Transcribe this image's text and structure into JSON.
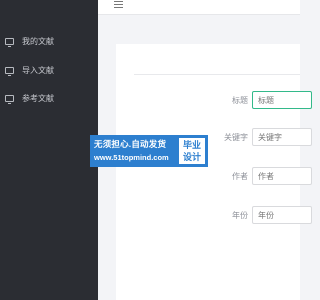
{
  "sidebar": {
    "items": [
      {
        "label": "我的文献",
        "icon": "monitor-icon"
      },
      {
        "label": "导入文献",
        "icon": "monitor-icon"
      },
      {
        "label": "参考文献",
        "icon": "monitor-icon"
      }
    ]
  },
  "header": {
    "menu_icon": "hamburger-icon"
  },
  "form": {
    "fields": [
      {
        "label": "标题",
        "placeholder": "标题"
      },
      {
        "label": "关键字",
        "placeholder": "关键字"
      },
      {
        "label": "作者",
        "placeholder": "作者"
      },
      {
        "label": "年份",
        "placeholder": "年份"
      }
    ]
  },
  "watermark": {
    "line1": "无须担心.自动发货",
    "line2": "www.51topmind.com",
    "badge_line1": "毕业",
    "badge_line2": "设计"
  },
  "colors": {
    "sidebar_bg": "#2b2d33",
    "active_border": "#33b98a",
    "watermark_bg": "#2d7fcf"
  }
}
